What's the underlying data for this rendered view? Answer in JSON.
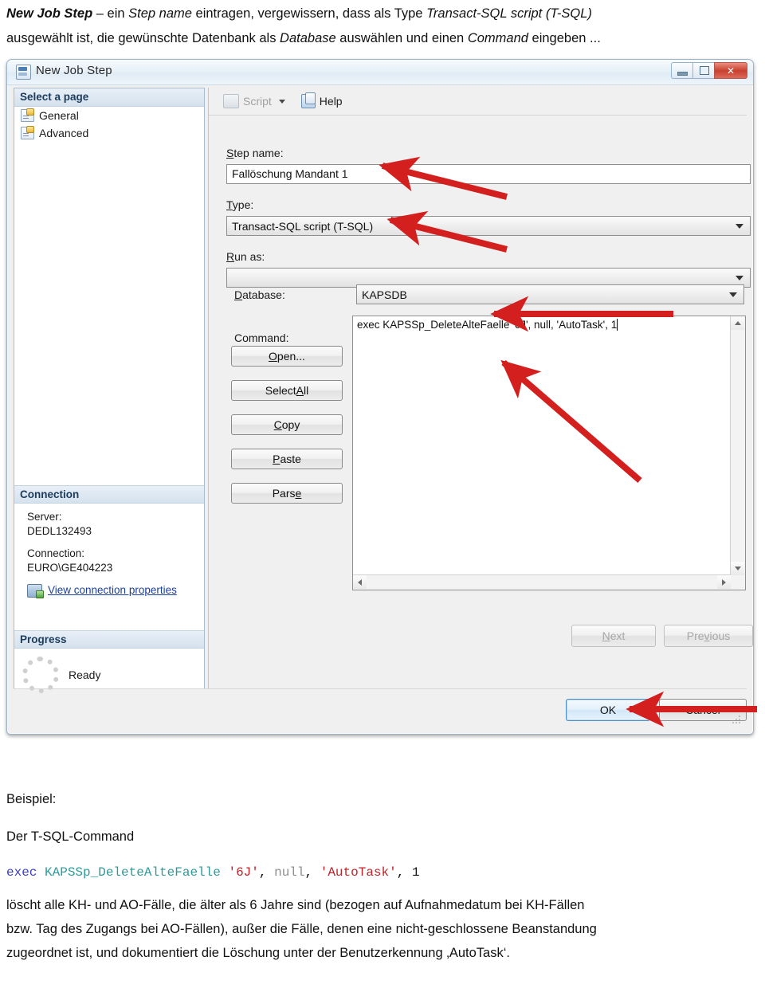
{
  "document": {
    "intro_line1_pre": "New Job Step",
    "intro_line1_mid": " – ein ",
    "intro_line1_em2": "Step name",
    "intro_line1_post": " eintragen, vergewissern, dass als Type ",
    "intro_line1_em3": "Transact-SQL script (T-SQL)",
    "intro_line2_pre": "ausgewählt ist, die gewünschte Datenbank als ",
    "intro_line2_em1": "Database",
    "intro_line2_mid": " auswählen und einen ",
    "intro_line2_em2": "Command",
    "intro_line2_post": " eingeben ...",
    "beispiel_label": "Beispiel:",
    "tsql_label": "Der T-SQL-Command",
    "code": {
      "keyword": "exec",
      "procedure": "KAPSSp_DeleteAlteFaelle",
      "arg1": "'6J'",
      "sep1": ",",
      "arg2": "null",
      "sep2": ",",
      "arg3": "'AutoTask'",
      "sep3": ",",
      "arg4": "1"
    },
    "para_line1": "löscht alle KH- und AO-Fälle, die älter als 6 Jahre sind (bezogen auf Aufnahmedatum bei  KH-Fällen",
    "para_line2": "bzw. Tag des Zugangs bei AO-Fällen), außer die Fälle, denen eine nicht-geschlossene Beanstandung",
    "para_line3": "zugeordnet ist, und dokumentiert die Löschung unter der Benutzerkennung ‚AutoTask‘."
  },
  "dialog": {
    "title": "New Job Step",
    "window_buttons": {
      "minimize": "minimize-button",
      "maximize": "maximize-button",
      "close_glyph": "✕"
    },
    "nav": {
      "header": "Select a page",
      "items": [
        {
          "label": "General"
        },
        {
          "label": "Advanced"
        }
      ]
    },
    "connection": {
      "header": "Connection",
      "server_label": "Server:",
      "server_value": "DEDL132493",
      "connection_label": "Connection:",
      "connection_value": "EURO\\GE404223",
      "properties_link": "View connection properties"
    },
    "progress": {
      "header": "Progress",
      "status": "Ready"
    },
    "toolbar": {
      "script_label": "Script",
      "help_label": "Help"
    },
    "form": {
      "step_name_label": "Step name:",
      "step_name_value": "Fallöschung Mandant 1",
      "type_label": "Type:",
      "type_value": "Transact-SQL script (T-SQL)",
      "run_as_label": "Run as:",
      "run_as_value": "",
      "database_label": "Database:",
      "database_value": "KAPSDB",
      "command_label": "Command:",
      "command_value": "exec KAPSSp_DeleteAlteFaelle '6J', null, 'AutoTask', 1"
    },
    "command_buttons": [
      {
        "label": "Open...",
        "name": "open-button"
      },
      {
        "label": "Select All",
        "name": "select-all-button"
      },
      {
        "label": "Copy",
        "name": "copy-button"
      },
      {
        "label": "Paste",
        "name": "paste-button"
      },
      {
        "label": "Parse",
        "name": "parse-button"
      }
    ],
    "nav_buttons": [
      {
        "label": "Next",
        "name": "next-button"
      },
      {
        "label": "Previous",
        "name": "previous-button"
      }
    ],
    "footer_buttons": [
      {
        "label": "OK",
        "name": "ok-button"
      },
      {
        "label": "Cancel",
        "name": "cancel-button"
      }
    ]
  },
  "colors": {
    "annotation_arrow": "#d41f1f",
    "link": "#1a3fa0",
    "header_text": "#1c3c5c"
  }
}
